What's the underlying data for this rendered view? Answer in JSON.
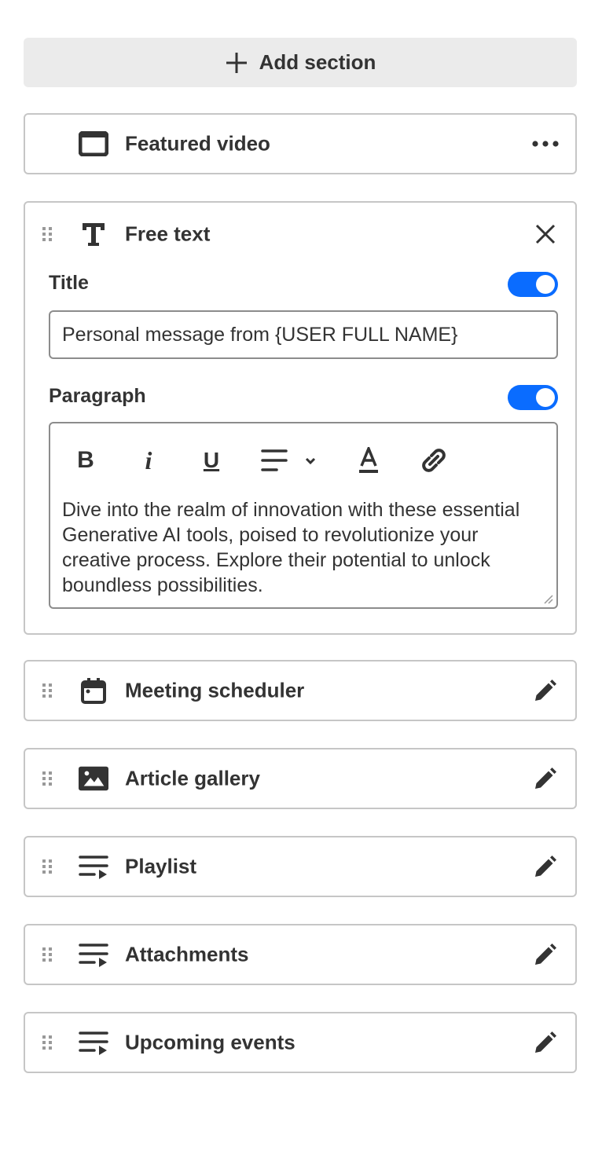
{
  "add_section": {
    "label": "Add section",
    "icon": "plus-icon"
  },
  "featured": {
    "label": "Featured video",
    "icon": "video-icon",
    "action": "more-icon"
  },
  "free_text": {
    "label": "Free text",
    "icon": "text-icon",
    "action": "close-icon",
    "title": {
      "label": "Title",
      "enabled": true,
      "value": "Personal message from {USER FULL NAME}"
    },
    "paragraph": {
      "label": "Paragraph",
      "enabled": true,
      "toolbar": [
        "bold",
        "italic",
        "underline",
        "align",
        "text-color",
        "link"
      ],
      "text": "Dive into the realm of innovation with these essential Generative AI tools, poised to revolutionize your creative process. Explore their potential to unlock boundless possibilities."
    }
  },
  "sections": [
    {
      "label": "Meeting scheduler",
      "icon": "calendar-icon"
    },
    {
      "label": "Article gallery",
      "icon": "image-icon"
    },
    {
      "label": "Playlist",
      "icon": "playlist-icon"
    },
    {
      "label": "Attachments",
      "icon": "playlist-icon"
    },
    {
      "label": "Upcoming events",
      "icon": "playlist-icon"
    }
  ],
  "colors": {
    "accent": "#0a6cff",
    "text": "#333333",
    "border": "#c6c6c6"
  }
}
